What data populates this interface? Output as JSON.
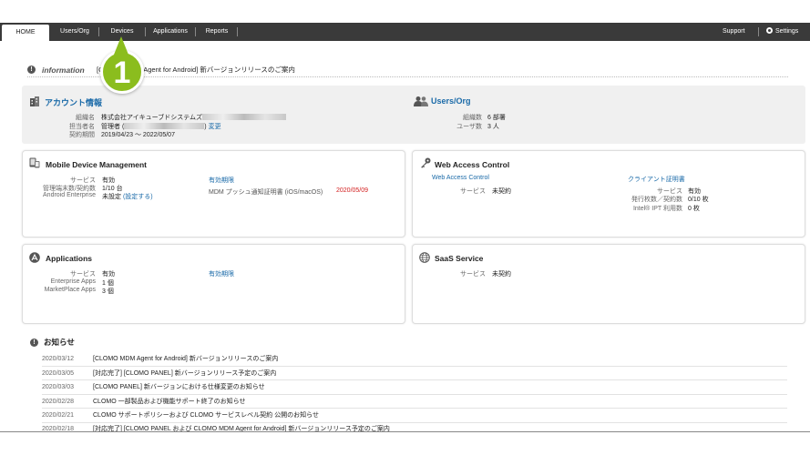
{
  "nav": {
    "tabs": [
      "HOME",
      "Users/Org",
      "Devices",
      "Applications",
      "Reports"
    ],
    "support": "Support",
    "settings": "Settings"
  },
  "info": {
    "label": "information",
    "text": "[CLOMO MDM Agent for Android] 新バージョンリリースのご案内"
  },
  "callout": {
    "number": "1"
  },
  "account": {
    "title": "アカウント情報",
    "org_label": "組織名",
    "org_value": "株式会社アイキューブドシステムズ",
    "manager_label": "担当者名",
    "manager_value": "管理者 (",
    "manager_close": ")",
    "change_link": "変更",
    "period_label": "契約期間",
    "period_value": "2019/04/23 ～ 2022/05/07"
  },
  "users_org": {
    "title": "Users/Org",
    "org_count_label": "組織数",
    "org_count_value": "6 部署",
    "user_count_label": "ユーザ数",
    "user_count_value": "3 人"
  },
  "mdm": {
    "title": "Mobile Device Management",
    "service_label": "サービス",
    "service_value": "有効",
    "devices_label": "管理端末数/契約数",
    "devices_value": "1/10 台",
    "android_label": "Android Enterprise",
    "android_value": "未設定",
    "android_link": "(設定する)",
    "expiry_label": "有効期限",
    "push_label": "MDM プッシュ通知証明書 (iOS/macOS)",
    "push_value": "2020/05/09"
  },
  "wac": {
    "title": "Web Access Control",
    "sub_link": "Web Access Control",
    "service_label": "サービス",
    "service_value": "未契約",
    "cert_link": "クライアント証明書",
    "cert_service_label": "サービス",
    "cert_service_value": "有効",
    "issued_label": "発行枚数／契約数",
    "issued_value": "0/10 枚",
    "ipt_label": "Intel® IPT 利用数",
    "ipt_value": "0 枚"
  },
  "apps": {
    "title": "Applications",
    "service_label": "サービス",
    "service_value": "有効",
    "enterprise_label": "Enterprise Apps",
    "enterprise_value": "1 個",
    "marketplace_label": "MarketPlace Apps",
    "marketplace_value": "3 個",
    "expiry_label": "有効期限"
  },
  "saas": {
    "title": "SaaS Service",
    "service_label": "サービス",
    "service_value": "未契約"
  },
  "news": {
    "title": "お知らせ",
    "items": [
      {
        "date": "2020/03/12",
        "text": "[CLOMO MDM Agent for Android] 新バージョンリリースのご案内"
      },
      {
        "date": "2020/03/05",
        "text": "[対応完了] [CLOMO PANEL] 新バージョンリリース予定のご案内"
      },
      {
        "date": "2020/03/03",
        "text": "[CLOMO PANEL] 新バージョンにおける仕様変更のお知らせ"
      },
      {
        "date": "2020/02/28",
        "text": "CLOMO 一部製品および機能サポート終了のお知らせ"
      },
      {
        "date": "2020/02/21",
        "text": "CLOMO サポートポリシーおよび CLOMO サービスレベル契約 公開のお知らせ"
      },
      {
        "date": "2020/02/18",
        "text": "[対応完了] [CLOMO PANEL および CLOMO MDM Agent for Android] 新バージョンリリース予定のご案内"
      }
    ]
  },
  "colors": {
    "nav_bg": "#3a3a3a",
    "link": "#1a6aa8",
    "alert": "#d32020",
    "callout": "#8bbd1e"
  }
}
